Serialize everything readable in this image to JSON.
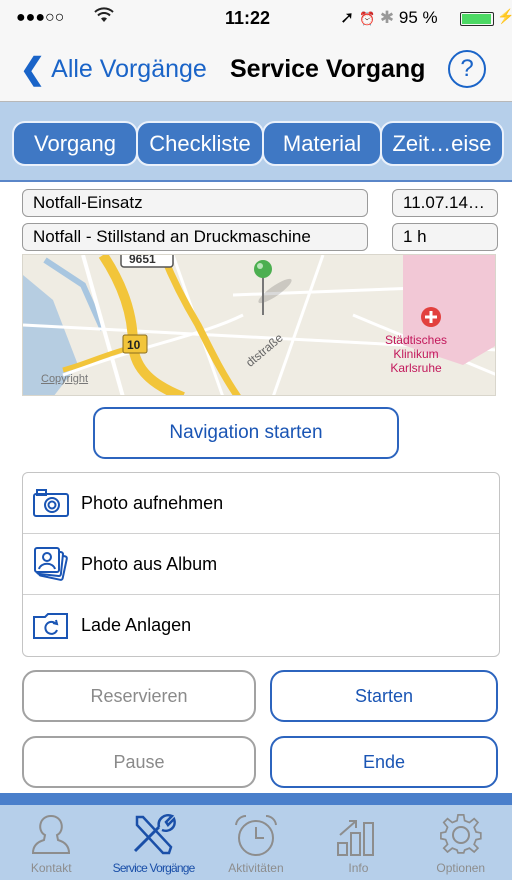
{
  "status_bar": {
    "signal": "●●●○○",
    "wifi_icon": "wifi-icon",
    "time": "11:22",
    "battery_percent_text": "95 %",
    "battery_level": 0.95,
    "battery_color": "#4cd964"
  },
  "nav": {
    "back_label": "Alle Vorgänge",
    "title": "Service Vorgang",
    "help_label": "?",
    "accent_color": "#1a64c8"
  },
  "tabs": [
    {
      "label": "Vorgang"
    },
    {
      "label": "Checkliste"
    },
    {
      "label": "Material"
    },
    {
      "label": "Zeit…eise"
    }
  ],
  "details": {
    "type": "Notfall-Einsatz",
    "date": "11.07.14…",
    "description": "Notfall - Stillstand an Druckmaschine",
    "duration": "1 h"
  },
  "map": {
    "road_label_top": "9651",
    "road_label_bottom": "10",
    "street_label": "dtstraße",
    "hospital_line1": "Städtisches",
    "hospital_line2": "Klinikum",
    "hospital_line3": "Karlsruhe",
    "copyright": "Copyright"
  },
  "navigation_button": "Navigation starten",
  "actions": [
    {
      "label": "Photo aufnehmen",
      "icon": "camera-icon"
    },
    {
      "label": "Photo aus Album",
      "icon": "photo-album-icon"
    },
    {
      "label": "Lade Anlagen",
      "icon": "reload-folder-icon"
    }
  ],
  "buttons": {
    "reserve": "Reservieren",
    "start": "Starten",
    "pause": "Pause",
    "end": "Ende"
  },
  "tabbar": [
    {
      "label": "Kontakt",
      "icon": "person-icon"
    },
    {
      "label": "Service Vorgänge",
      "icon": "tools-icon"
    },
    {
      "label": "Aktivitäten",
      "icon": "alarm-clock-icon"
    },
    {
      "label": "Info",
      "icon": "bar-chart-icon"
    },
    {
      "label": "Optionen",
      "icon": "gear-icon"
    }
  ]
}
